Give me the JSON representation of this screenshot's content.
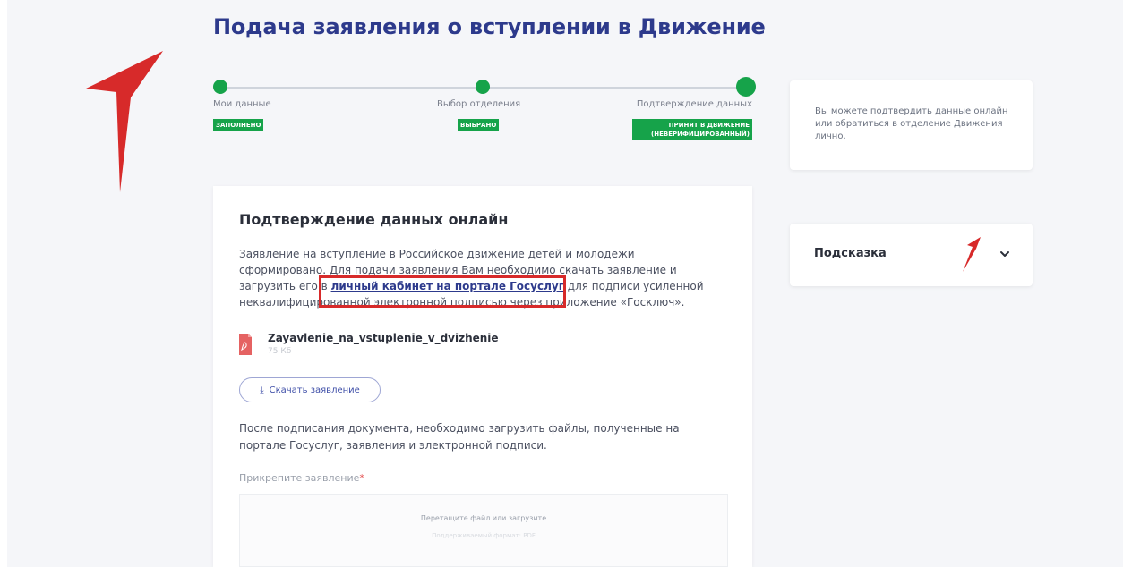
{
  "header": {
    "title": "Подача заявления о вступлении в Движение"
  },
  "steps": [
    {
      "label": "Мои данные",
      "badge": "ЗАПОЛНЕНО"
    },
    {
      "label": "Выбор отделения",
      "badge": "ВЫБРАНО"
    },
    {
      "label": "Подтверждение данных",
      "badge": "ПРИНЯТ В ДВИЖЕНИЕ (НЕВЕРИФИЦИРОВАННЫЙ)"
    }
  ],
  "info_card": {
    "text": "Вы можете подтвердить данные онлайн или обратиться в отделение Движения лично."
  },
  "hint_card": {
    "title": "Подсказка"
  },
  "main": {
    "title": "Подтверждение данных онлайн",
    "para_before": "Заявление на вступление в Российское движение детей и молодежи сформировано. Для подачи заявления Вам необходимо скачать заявление и загрузить его в ",
    "link_text": "личный кабинет на портале Госуслуг",
    "para_after": " для подписи усиленной неквалифицированной электронной подписью через приложение «Госключ».",
    "file_name": "Zayavlenie_na_vstuplenie_v_dvizhenie",
    "file_size": "75 Кб",
    "download_label": "Скачать заявление",
    "after_text": "После подписания документа, необходимо загрузить файлы, полученные на портале Госуслуг, заявления и электронной подписи.",
    "attach_label": "Прикрепите заявление",
    "required_mark": "*",
    "dropzone_text": "Перетащите файл или загрузите",
    "dropzone_hint": "Поддерживаемый формат: PDF"
  },
  "colors": {
    "brand": "#2d3a8c",
    "success": "#16a34a",
    "annotation": "#d72a2a"
  }
}
